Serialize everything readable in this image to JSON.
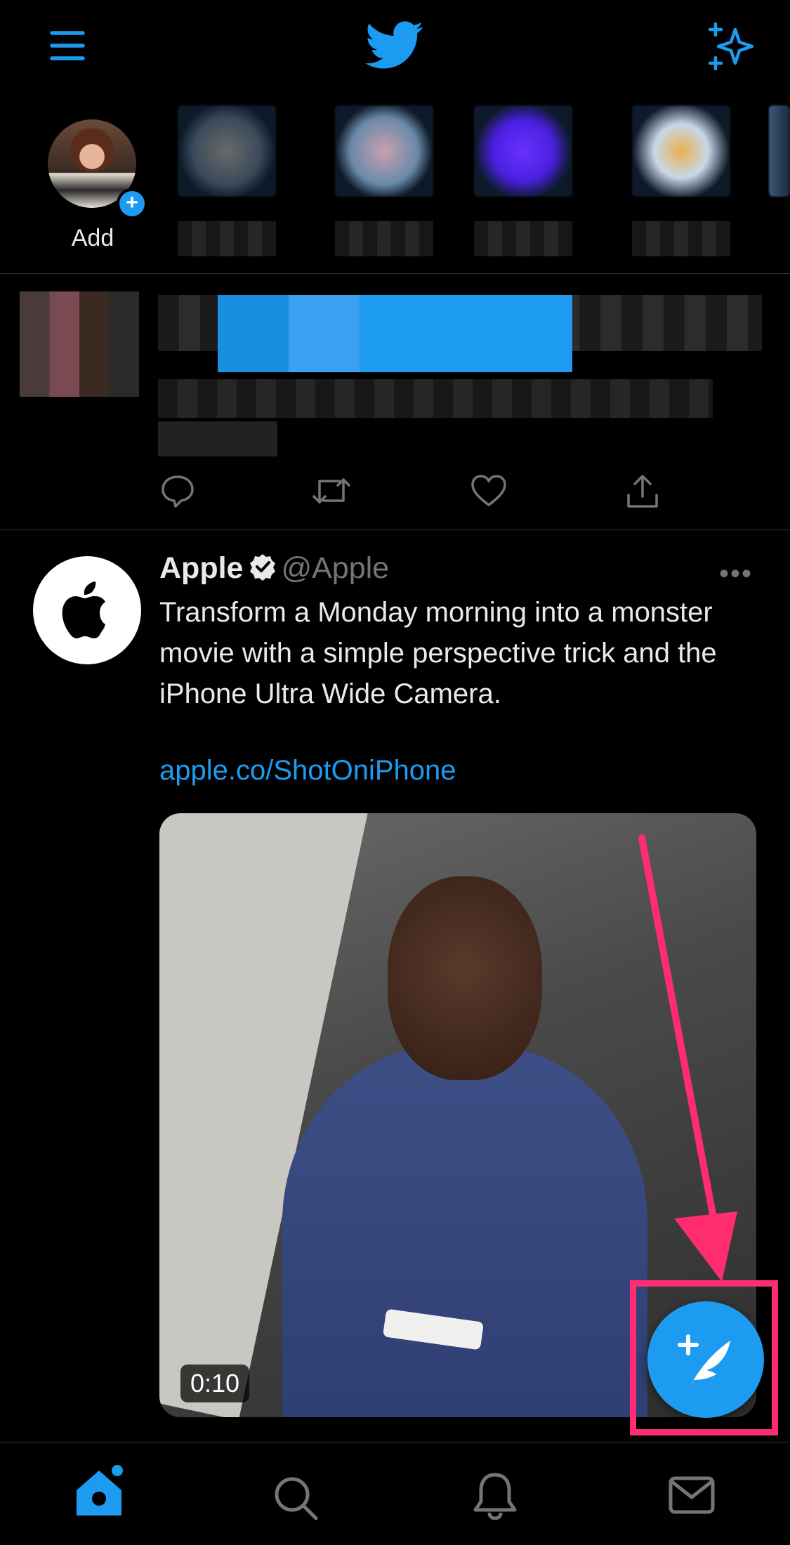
{
  "header": {
    "menu_icon": "hamburger-menu-icon",
    "logo_icon": "twitter-bird-icon",
    "sparkle_icon": "sparkle-icon"
  },
  "fleets": {
    "self_label": "Add",
    "add_icon": "plus-icon"
  },
  "blurred_tweet": {
    "actions": [
      "reply-icon",
      "retweet-icon",
      "like-icon",
      "share-icon"
    ]
  },
  "tweet": {
    "name": "Apple",
    "handle": "@Apple",
    "text": "Transform a Monday morning into a monster movie with a simple perspective trick and the iPhone Ultra Wide Camera.",
    "link": "apple.co/ShotOniPhone",
    "video_duration": "0:10",
    "more_label": "•••"
  },
  "compose_button": {
    "icon": "compose-tweet-icon"
  },
  "bottom_nav": {
    "items": [
      "home-icon",
      "search-icon",
      "notifications-icon",
      "messages-icon"
    ]
  },
  "colors": {
    "accent": "#1d9bf0",
    "annotation": "#ff2d6f",
    "background": "#000000",
    "secondary_text": "#71767b"
  }
}
